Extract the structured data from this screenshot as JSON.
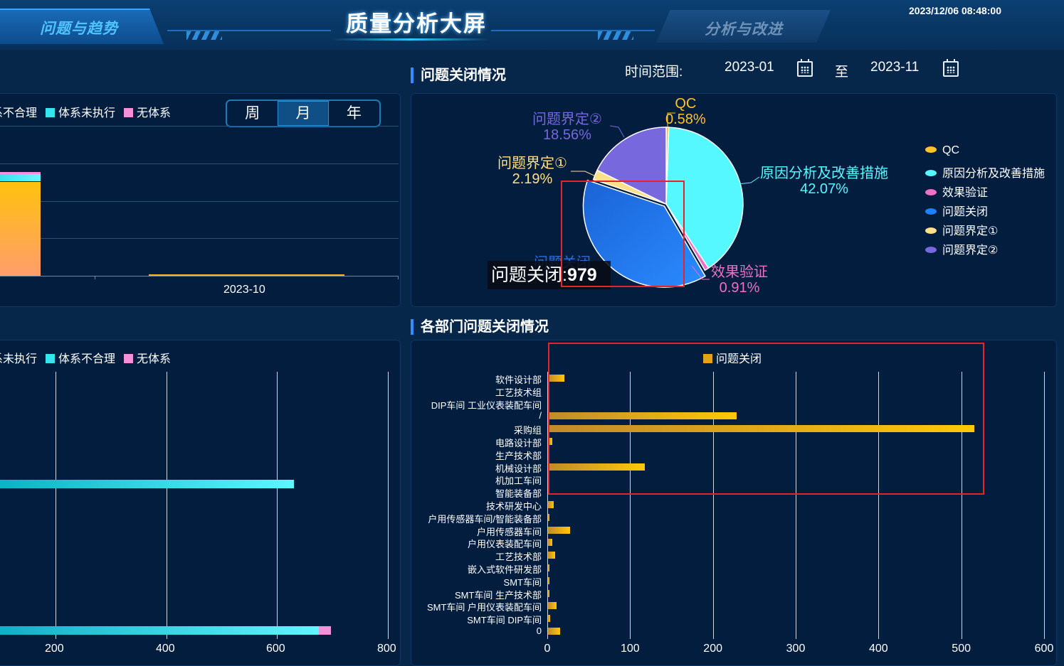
{
  "header": {
    "title": "质量分析大屏",
    "tab_left": "问题与趋势",
    "tab_right": "分析与改进",
    "datetime": "2023/12/06 08:48:00"
  },
  "top_left_panel": {
    "legend": [
      {
        "label": "系不合理",
        "color": "#ffc32a"
      },
      {
        "label": "体系未执行",
        "color": "#36e3ee"
      },
      {
        "label": "无体系",
        "color": "#f590d8"
      }
    ],
    "period": {
      "options": [
        "周",
        "月",
        "年"
      ],
      "selected": "月"
    },
    "x_label": "2023-10"
  },
  "bottom_left_panel": {
    "legend": [
      {
        "label": "系未执行",
        "color": "#ffc32a"
      },
      {
        "label": "体系不合理",
        "color": "#36e3ee"
      },
      {
        "label": "无体系",
        "color": "#f590d8"
      }
    ],
    "x_ticks": [
      "200",
      "400",
      "600",
      "800"
    ]
  },
  "closure_section": {
    "title": "问题关闭情况",
    "time_range_label": "时间范围:",
    "start": "2023-01",
    "to": "至",
    "end": "2023-11"
  },
  "dept_section": {
    "title": "各部门问题关闭情况"
  },
  "tooltip": {
    "name": "问题关闭",
    "value": "979"
  },
  "pie_ghost_label": "问题关闭",
  "chart_data": [
    {
      "type": "bar",
      "orientation": "vertical",
      "stacked": true,
      "categories": [
        "",
        "2023-10"
      ],
      "series": [
        {
          "name": "系不合理",
          "values": [
            500,
            20
          ],
          "color": "#ffc32a"
        },
        {
          "name": "体系未执行",
          "values": [
            40,
            0
          ],
          "color": "#36e3ee"
        },
        {
          "name": "无体系",
          "values": [
            10,
            0
          ],
          "color": "#f590d8"
        }
      ],
      "grid": true
    },
    {
      "type": "bar",
      "orientation": "horizontal",
      "stacked": true,
      "xlim": [
        0,
        800
      ],
      "series": [
        {
          "name": "体系不合理",
          "values": [
            630,
            675
          ],
          "color": "#36e3ee"
        },
        {
          "name": "无体系",
          "values": [
            0,
            22
          ],
          "color": "#f590d8"
        }
      ],
      "grid": true
    },
    {
      "type": "pie",
      "slices": [
        {
          "name": "QC",
          "value": 14,
          "percent": "0.58%",
          "color": "#ffc32a"
        },
        {
          "name": "原因分析及改善措施",
          "value": 1019,
          "percent": "42.07%",
          "color": "#56f8ff"
        },
        {
          "name": "效果验证",
          "value": 22,
          "percent": "0.91%",
          "color": "#f16fc6"
        },
        {
          "name": "问题关闭",
          "value": 979,
          "percent": "",
          "color": "#1f80ff"
        },
        {
          "name": "问题界定①",
          "value": 53,
          "percent": "2.19%",
          "color": "#ffe08a"
        },
        {
          "name": "问题界定②",
          "value": 450,
          "percent": "18.56%",
          "color": "#7768dd"
        }
      ],
      "legend_position": "right"
    },
    {
      "type": "bar",
      "orientation": "horizontal",
      "legend": "问题关闭",
      "xlim": [
        0,
        600
      ],
      "x_ticks": [
        0,
        100,
        200,
        300,
        400,
        500,
        600
      ],
      "categories": [
        "软件设计部",
        "工艺技术组",
        "DIP车间 工业仪表装配车间",
        "/",
        "采购组",
        "电路设计部",
        "生产技术部",
        "机械设计部",
        "机加工车间",
        "智能装备部",
        "技术研发中心",
        "户用传感器车间/智能装备部",
        "户用传感器车间",
        "户用仪表装配车间",
        "工艺技术部",
        "嵌入式软件研发部",
        "SMT车间",
        "SMT车间 生产技术部",
        "SMT车间 户用仪表装配车间",
        "SMT车间 DIP车间",
        "0"
      ],
      "values": [
        20,
        0,
        0,
        228,
        515,
        5,
        0,
        117,
        0,
        0,
        7,
        1,
        27,
        5,
        9,
        2,
        1,
        1,
        10,
        3,
        15
      ],
      "color": "#ffc107"
    }
  ]
}
